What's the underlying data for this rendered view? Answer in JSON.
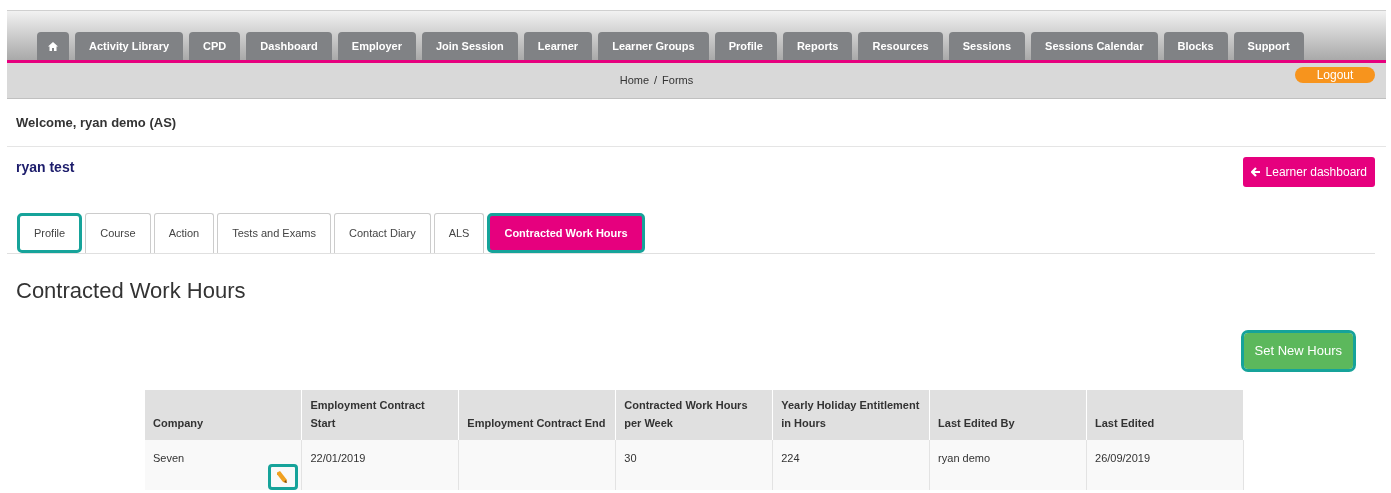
{
  "nav": {
    "home": {
      "selected": false
    },
    "items": [
      {
        "label": "Activity Library"
      },
      {
        "label": "CPD"
      },
      {
        "label": "Dashboard"
      },
      {
        "label": "Employer"
      },
      {
        "label": "Join Session"
      },
      {
        "label": "Learner"
      },
      {
        "label": "Learner Groups"
      },
      {
        "label": "Profile"
      },
      {
        "label": "Reports"
      },
      {
        "label": "Resources"
      },
      {
        "label": "Sessions"
      },
      {
        "label": "Sessions Calendar"
      },
      {
        "label": "Blocks"
      },
      {
        "label": "Support"
      }
    ]
  },
  "breadcrumb": {
    "items": [
      "Home",
      "Forms"
    ],
    "separator": "/"
  },
  "logout": "Logout",
  "welcome": "Welcome, ryan demo (AS)",
  "learner_name": "ryan test",
  "learner_dashboard_button": {
    "label": "Learner dashboard"
  },
  "tabs": [
    {
      "label": "Profile",
      "selected": false,
      "highlighted": true
    },
    {
      "label": "Course",
      "selected": false,
      "highlighted": false
    },
    {
      "label": "Action",
      "selected": false,
      "highlighted": false
    },
    {
      "label": "Tests and Exams",
      "selected": false,
      "highlighted": false
    },
    {
      "label": "Contact Diary",
      "selected": false,
      "highlighted": false
    },
    {
      "label": "ALS",
      "selected": false,
      "highlighted": false
    },
    {
      "label": "Contracted Work Hours",
      "selected": true,
      "highlighted": true
    }
  ],
  "heading": "Contracted Work Hours",
  "set_new_hours_button": {
    "label": "Set New Hours",
    "highlighted": true
  },
  "table": {
    "columns": [
      "Company",
      "Employment Contract Start",
      "Employment Contract End",
      "Contracted Work Hours per Week",
      "Yearly Holiday Entitlement in Hours",
      "Last Edited By",
      "Last Edited"
    ],
    "rows": [
      {
        "cells": [
          "Seven",
          "22/01/2019",
          "",
          "30",
          "224",
          "ryan demo",
          "26/09/2019"
        ],
        "edit_highlighted": true
      }
    ]
  }
}
